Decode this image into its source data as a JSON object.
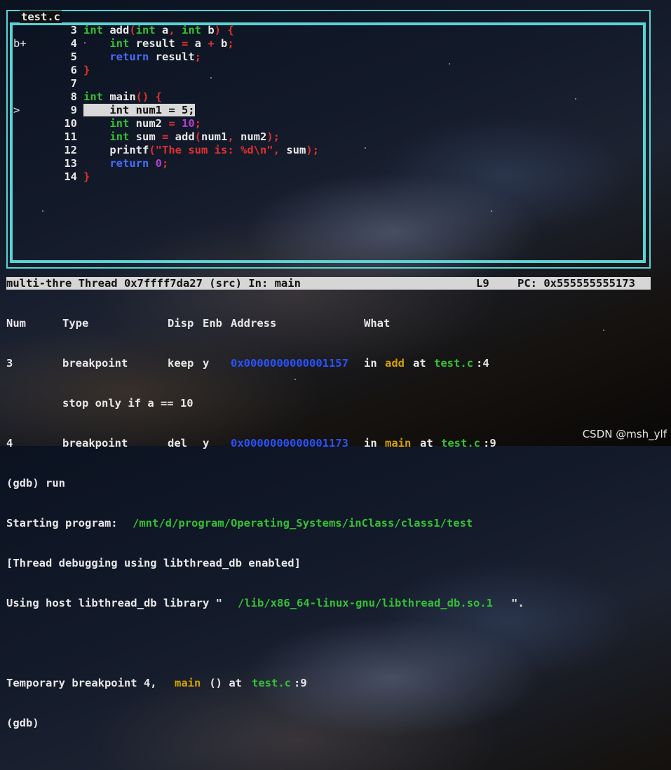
{
  "source_window": {
    "title": "test.c",
    "lines": [
      {
        "mark": "",
        "num": "3",
        "segments": [
          {
            "t": "int",
            "c": "kw-green"
          },
          {
            "t": " add",
            "c": "white"
          },
          {
            "t": "(",
            "c": "red"
          },
          {
            "t": "int",
            "c": "kw-green"
          },
          {
            "t": " a",
            "c": "white"
          },
          {
            "t": ", ",
            "c": "red"
          },
          {
            "t": "int",
            "c": "kw-green"
          },
          {
            "t": " b",
            "c": "white"
          },
          {
            "t": ") {",
            "c": "red"
          }
        ]
      },
      {
        "mark": "b+",
        "num": "4",
        "segments": [
          {
            "t": "    ",
            "c": "white"
          },
          {
            "t": "int",
            "c": "kw-green"
          },
          {
            "t": " result ",
            "c": "white"
          },
          {
            "t": "=",
            "c": "red"
          },
          {
            "t": " a ",
            "c": "white"
          },
          {
            "t": "+",
            "c": "red"
          },
          {
            "t": " b",
            "c": "white"
          },
          {
            "t": ";",
            "c": "red"
          }
        ]
      },
      {
        "mark": "",
        "num": "5",
        "segments": [
          {
            "t": "    ",
            "c": "white"
          },
          {
            "t": "return",
            "c": "kw-blue"
          },
          {
            "t": " result",
            "c": "white"
          },
          {
            "t": ";",
            "c": "red"
          }
        ]
      },
      {
        "mark": "",
        "num": "6",
        "segments": [
          {
            "t": "}",
            "c": "red"
          }
        ]
      },
      {
        "mark": "",
        "num": "7",
        "segments": []
      },
      {
        "mark": "",
        "num": "8",
        "segments": [
          {
            "t": "int",
            "c": "kw-green"
          },
          {
            "t": " main",
            "c": "white"
          },
          {
            "t": "() {",
            "c": "red"
          }
        ]
      },
      {
        "mark": ">",
        "num": "9",
        "highlight": true,
        "segments": [
          {
            "t": "    int num1 = 5;",
            "c": "hl"
          }
        ]
      },
      {
        "mark": "",
        "num": "10",
        "segments": [
          {
            "t": "    ",
            "c": "white"
          },
          {
            "t": "int",
            "c": "kw-green"
          },
          {
            "t": " num2 ",
            "c": "white"
          },
          {
            "t": "=",
            "c": "red"
          },
          {
            "t": " 10",
            "c": "purple"
          },
          {
            "t": ";",
            "c": "red"
          }
        ]
      },
      {
        "mark": "",
        "num": "11",
        "segments": [
          {
            "t": "    ",
            "c": "white"
          },
          {
            "t": "int",
            "c": "kw-green"
          },
          {
            "t": " sum ",
            "c": "white"
          },
          {
            "t": "=",
            "c": "red"
          },
          {
            "t": " add",
            "c": "white"
          },
          {
            "t": "(",
            "c": "red"
          },
          {
            "t": "num1",
            "c": "white"
          },
          {
            "t": ", ",
            "c": "red"
          },
          {
            "t": "num2",
            "c": "white"
          },
          {
            "t": ");",
            "c": "red"
          }
        ]
      },
      {
        "mark": "",
        "num": "12",
        "segments": [
          {
            "t": "    printf",
            "c": "white"
          },
          {
            "t": "(",
            "c": "red"
          },
          {
            "t": "\"The sum is: %d\\n\"",
            "c": "red"
          },
          {
            "t": ", ",
            "c": "red"
          },
          {
            "t": "sum",
            "c": "white"
          },
          {
            "t": ");",
            "c": "red"
          }
        ]
      },
      {
        "mark": "",
        "num": "13",
        "segments": [
          {
            "t": "    ",
            "c": "white"
          },
          {
            "t": "return",
            "c": "kw-blue"
          },
          {
            "t": " 0",
            "c": "purple"
          },
          {
            "t": ";",
            "c": "red"
          }
        ]
      },
      {
        "mark": "",
        "num": "14",
        "segments": [
          {
            "t": "}",
            "c": "red"
          }
        ]
      }
    ]
  },
  "status_bar": {
    "left": "multi-thre Thread 0x7ffff7da27 (src) In: main",
    "line": "L9",
    "pc": "PC: 0x555555555173"
  },
  "breakpoint_table": {
    "headers": {
      "num": "Num",
      "type": "Type",
      "disp": "Disp",
      "enb": "Enb",
      "address": "Address",
      "what": "What"
    },
    "rows": [
      {
        "num": "3",
        "type": "breakpoint",
        "disp": "keep",
        "enb": "y",
        "address": "0x0000000000001157",
        "what_in": "in",
        "fn": "add",
        "what_at": "at",
        "file": "test.c",
        "line": ":4"
      },
      {
        "condition": "stop only if a == 10"
      },
      {
        "num": "4",
        "type": "breakpoint",
        "disp": "del",
        "enb": "y",
        "address": "0x0000000000001173",
        "what_in": "in",
        "fn": "main",
        "what_at": "at",
        "file": "test.c",
        "line": ":9"
      }
    ]
  },
  "console": {
    "run_cmd": "(gdb) run",
    "starting_prefix": "Starting program: ",
    "starting_path": "/mnt/d/program/Operating_Systems/inClass/class1/test",
    "thread_debug": "[Thread debugging using libthread_db enabled]",
    "host_prefix": "Using host libthread_db library \"",
    "host_path": "/lib/x86_64-linux-gnu/libthread_db.so.1",
    "host_suffix": "\".",
    "temp_prefix": "Temporary breakpoint 4, ",
    "temp_fn": "main",
    "temp_mid": " () at ",
    "temp_file": "test.c",
    "temp_line": ":9",
    "prompt": "(gdb)"
  },
  "watermark": "CSDN @msh_ylf"
}
